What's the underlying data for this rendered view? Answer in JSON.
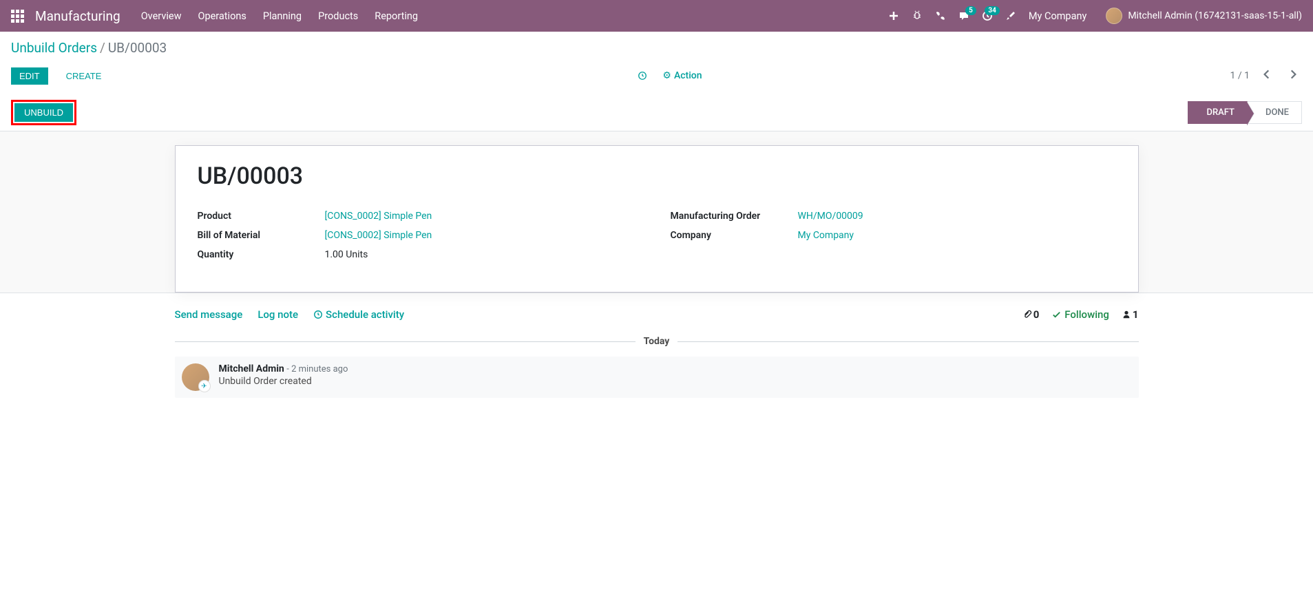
{
  "header": {
    "brand": "Manufacturing",
    "menu": [
      "Overview",
      "Operations",
      "Planning",
      "Products",
      "Reporting"
    ],
    "company": "My Company",
    "user": "Mitchell Admin (16742131-saas-15-1-all)",
    "badges": {
      "messages": "5",
      "activities": "34"
    }
  },
  "breadcrumb": {
    "prev": "Unbuild Orders",
    "current": "UB/00003"
  },
  "toolbar": {
    "edit": "Edit",
    "create": "Create",
    "action": "Action",
    "pager": "1 / 1"
  },
  "statusbar": {
    "unbuild": "Unbuild",
    "stages": {
      "draft": "Draft",
      "done": "Done"
    }
  },
  "record": {
    "title": "UB/00003",
    "labels": {
      "product": "Product",
      "bom": "Bill of Material",
      "qty": "Quantity",
      "mo": "Manufacturing Order",
      "company": "Company"
    },
    "values": {
      "product": "[CONS_0002] Simple Pen",
      "bom": "[CONS_0002] Simple Pen",
      "qty": "1.00",
      "qty_unit": "Units",
      "mo": "WH/MO/00009",
      "company": "My Company"
    }
  },
  "chatter": {
    "send": "Send message",
    "log": "Log note",
    "schedule": "Schedule activity",
    "attachments": "0",
    "following": "Following",
    "followers": "1",
    "separator": "Today",
    "message": {
      "author": "Mitchell Admin",
      "time": "- 2 minutes ago",
      "body": "Unbuild Order created"
    }
  }
}
